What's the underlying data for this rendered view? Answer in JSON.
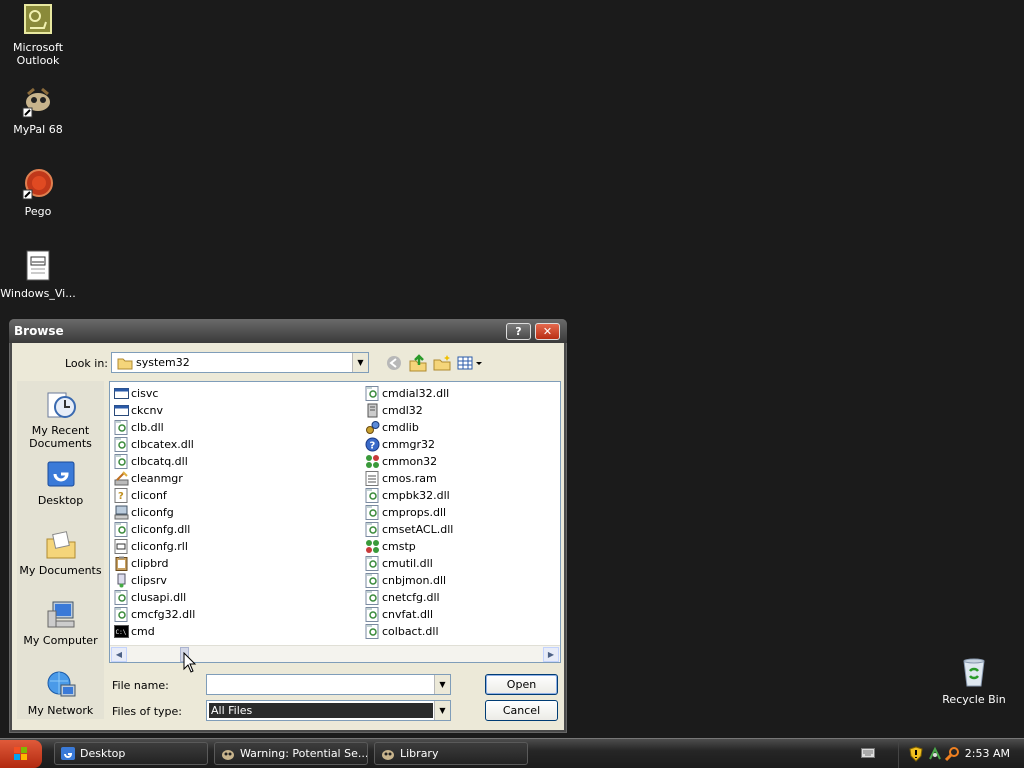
{
  "desktop": {
    "icons": [
      {
        "label": "Microsoft Outlook"
      },
      {
        "label": "MyPal 68"
      },
      {
        "label": "Pego"
      },
      {
        "label": "Windows_Vi..."
      }
    ],
    "recycle_bin": {
      "label": "Recycle Bin"
    }
  },
  "dialog": {
    "title": "Browse",
    "help_label": "?",
    "close_label": "✕",
    "look_in": {
      "label": "Look in:",
      "value": "system32"
    },
    "places": [
      {
        "label": "My Recent Documents"
      },
      {
        "label": "Desktop"
      },
      {
        "label": "My Documents"
      },
      {
        "label": "My Computer"
      },
      {
        "label": "My Network"
      }
    ],
    "files_col1": [
      {
        "name": "cisvc",
        "icon": "exe-window-icon"
      },
      {
        "name": "ckcnv",
        "icon": "exe-window-icon"
      },
      {
        "name": "clb.dll",
        "icon": "dll-icon"
      },
      {
        "name": "clbcatex.dll",
        "icon": "dll-icon"
      },
      {
        "name": "clbcatq.dll",
        "icon": "dll-icon"
      },
      {
        "name": "cleanmgr",
        "icon": "cleanmgr-icon"
      },
      {
        "name": "cliconf",
        "icon": "help-file-icon"
      },
      {
        "name": "cliconfg",
        "icon": "computer-config-icon"
      },
      {
        "name": "cliconfg.dll",
        "icon": "dll-icon"
      },
      {
        "name": "cliconfg.rll",
        "icon": "rll-icon"
      },
      {
        "name": "clipbrd",
        "icon": "clipboard-icon"
      },
      {
        "name": "clipsrv",
        "icon": "clipsrv-icon"
      },
      {
        "name": "clusapi.dll",
        "icon": "dll-icon"
      },
      {
        "name": "cmcfg32.dll",
        "icon": "dll-icon"
      },
      {
        "name": "cmd",
        "icon": "cmd-icon"
      }
    ],
    "files_col2": [
      {
        "name": "cmdial32.dll",
        "icon": "dll-icon"
      },
      {
        "name": "cmdl32",
        "icon": "cmdl32-icon"
      },
      {
        "name": "cmdlib",
        "icon": "gears-icon"
      },
      {
        "name": "cmmgr32",
        "icon": "question-icon"
      },
      {
        "name": "cmmon32",
        "icon": "cmmon-icon"
      },
      {
        "name": "cmos.ram",
        "icon": "ram-file-icon"
      },
      {
        "name": "cmpbk32.dll",
        "icon": "dll-icon"
      },
      {
        "name": "cmprops.dll",
        "icon": "dll-icon"
      },
      {
        "name": "cmsetACL.dll",
        "icon": "dll-icon"
      },
      {
        "name": "cmstp",
        "icon": "cmstp-icon"
      },
      {
        "name": "cmutil.dll",
        "icon": "dll-icon"
      },
      {
        "name": "cnbjmon.dll",
        "icon": "dll-icon"
      },
      {
        "name": "cnetcfg.dll",
        "icon": "dll-icon"
      },
      {
        "name": "cnvfat.dll",
        "icon": "dll-icon"
      },
      {
        "name": "colbact.dll",
        "icon": "dll-icon"
      }
    ],
    "file_name": {
      "label": "File name:",
      "value": ""
    },
    "file_type": {
      "label": "Files of type:",
      "value": "All Files"
    },
    "open_label": "Open",
    "cancel_label": "Cancel"
  },
  "taskbar": {
    "tasks": [
      {
        "label": "Desktop"
      },
      {
        "label": "Warning: Potential Se..."
      },
      {
        "label": "Library"
      }
    ],
    "clock": "2:53 AM"
  }
}
